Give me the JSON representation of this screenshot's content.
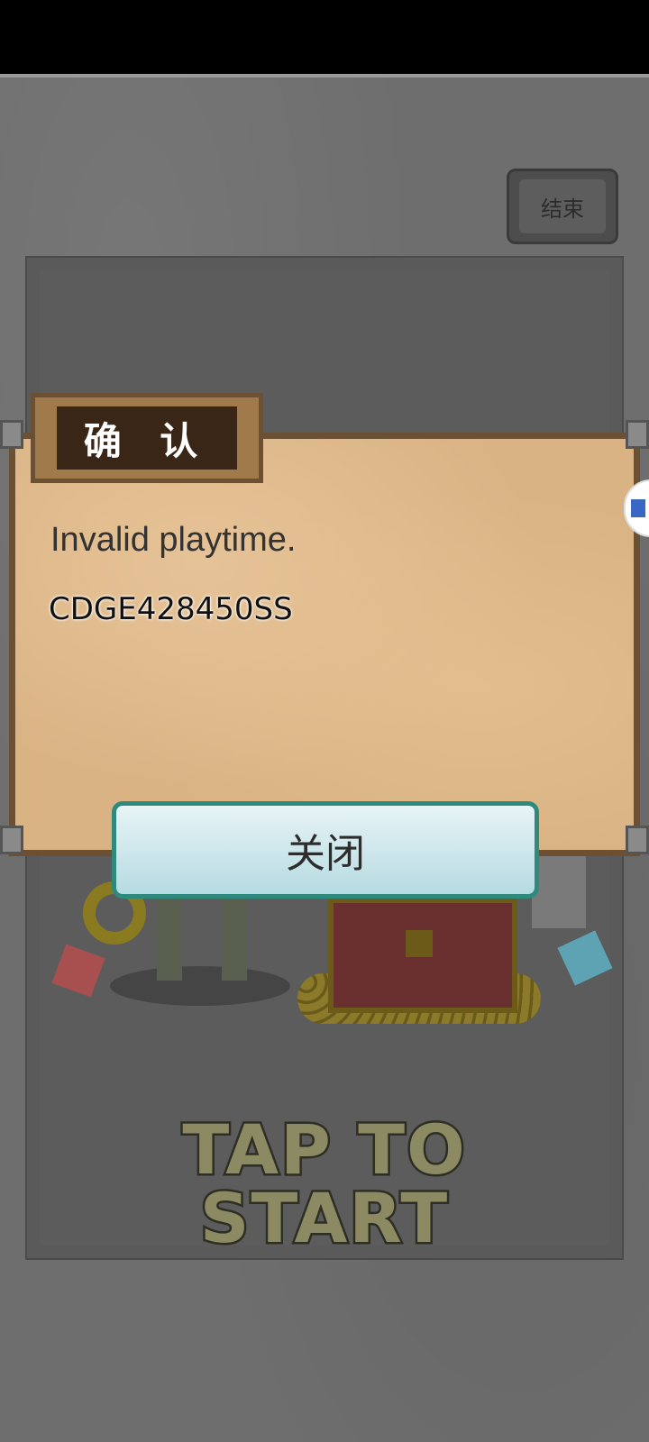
{
  "app": {
    "end_button": "结束",
    "tap_to_start": "TAP TO START"
  },
  "dialog": {
    "title": "确 认",
    "message": "Invalid playtime.",
    "code": "CDGE428450SS",
    "close_button": "关闭"
  },
  "icons": {
    "side_fab": "floating-assistant-icon"
  },
  "colors": {
    "paper": "#d9b384",
    "close_button_border": "#2f8a7e",
    "background": "#6e6e6e"
  }
}
